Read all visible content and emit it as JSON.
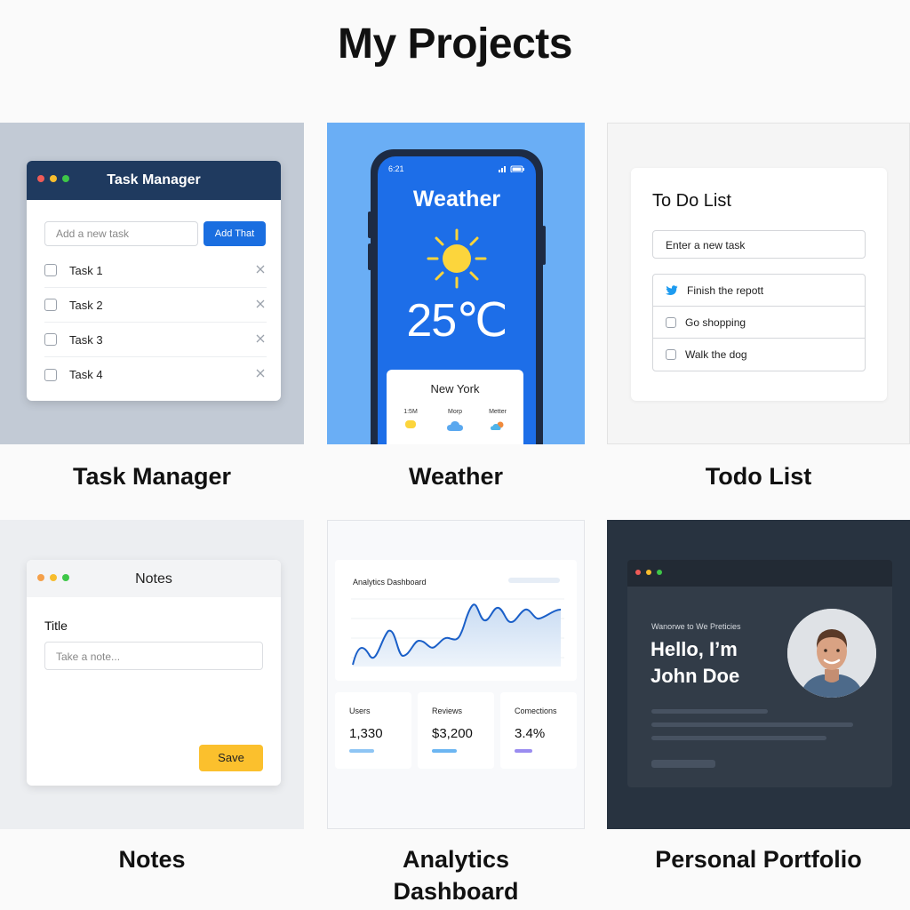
{
  "page": {
    "title": "My Projects"
  },
  "projects": [
    {
      "caption": "Task Manager",
      "window_title": "Task Manager",
      "input_placeholder": "Add a new task",
      "add_label": "Add That",
      "tasks": [
        "Task 1",
        "Task 2",
        "Task 3",
        "Task 4"
      ]
    },
    {
      "caption": "Weather",
      "time": "6:21",
      "title": "Weather",
      "temperature": "25℃",
      "city": "New York",
      "forecast": [
        {
          "label": "1:5M",
          "icon": "sun-icon"
        },
        {
          "label": "Morp",
          "icon": "cloud-icon"
        },
        {
          "label": "Metter",
          "icon": "partly-cloudy-icon"
        }
      ]
    },
    {
      "caption": "Todo List",
      "title": "To Do List",
      "input_value": "Enter a new task",
      "items": [
        {
          "text": "Finish the repott",
          "icon": "bird-icon"
        },
        {
          "text": "Go shopping",
          "icon": "checkbox-icon"
        },
        {
          "text": "Walk the dog",
          "icon": "checkbox-icon"
        }
      ]
    },
    {
      "caption": "Notes",
      "window_title": "Notes",
      "field_label": "Title",
      "input_placeholder": "Take a note...",
      "save_label": "Save"
    },
    {
      "caption": "Analytics Dashboard",
      "caption_line1": "Analytics",
      "caption_line2": "Dashboard",
      "title": "Analytics Dashboard",
      "stats": [
        {
          "label": "Users",
          "value": "1,330",
          "color": "#8ec5f4"
        },
        {
          "label": "Reviews",
          "value": "$3,200",
          "color": "#6cb6f2"
        },
        {
          "label": "Comections",
          "value": "3.4%",
          "color": "#9a8cf0"
        }
      ]
    },
    {
      "caption": "Personal Portfolio",
      "subtitle": "Wanorwe to We Preticies",
      "greeting_line1": "Hello, I’m",
      "greeting_line2": "John Doe"
    }
  ],
  "colors": {
    "task_header": "#1f3a5f",
    "task_add_button": "#1a6ee0",
    "weather_bg": "#1d6ee8",
    "notes_save": "#fbc02d",
    "portfolio_bg": "#283340"
  }
}
